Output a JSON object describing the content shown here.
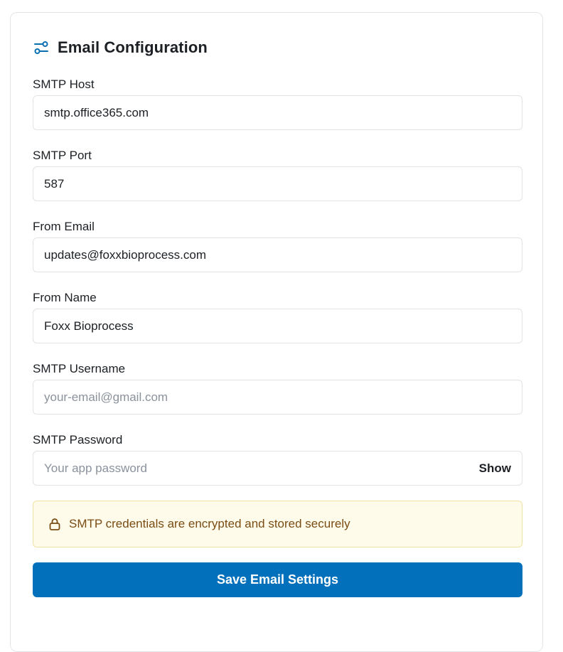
{
  "header": {
    "title": "Email Configuration",
    "icon": "sliders-icon"
  },
  "fields": {
    "smtp_host": {
      "label": "SMTP Host",
      "value": "smtp.office365.com"
    },
    "smtp_port": {
      "label": "SMTP Port",
      "value": "587"
    },
    "from_email": {
      "label": "From Email",
      "value": "updates@foxxbioprocess.com"
    },
    "from_name": {
      "label": "From Name",
      "value": "Foxx Bioprocess"
    },
    "smtp_username": {
      "label": "SMTP Username",
      "value": "",
      "placeholder": "your-email@gmail.com"
    },
    "smtp_password": {
      "label": "SMTP Password",
      "value": "",
      "placeholder": "Your app password",
      "toggle_label": "Show"
    }
  },
  "notice": {
    "icon": "lock-icon",
    "text": "SMTP credentials are encrypted and stored securely"
  },
  "actions": {
    "save_label": "Save Email Settings"
  },
  "colors": {
    "accent": "#0270BA",
    "icon": "#0A6FB0",
    "notice_bg": "#FEFBEA",
    "notice_border": "#F2E2A3",
    "notice_text": "#7A4C14"
  }
}
